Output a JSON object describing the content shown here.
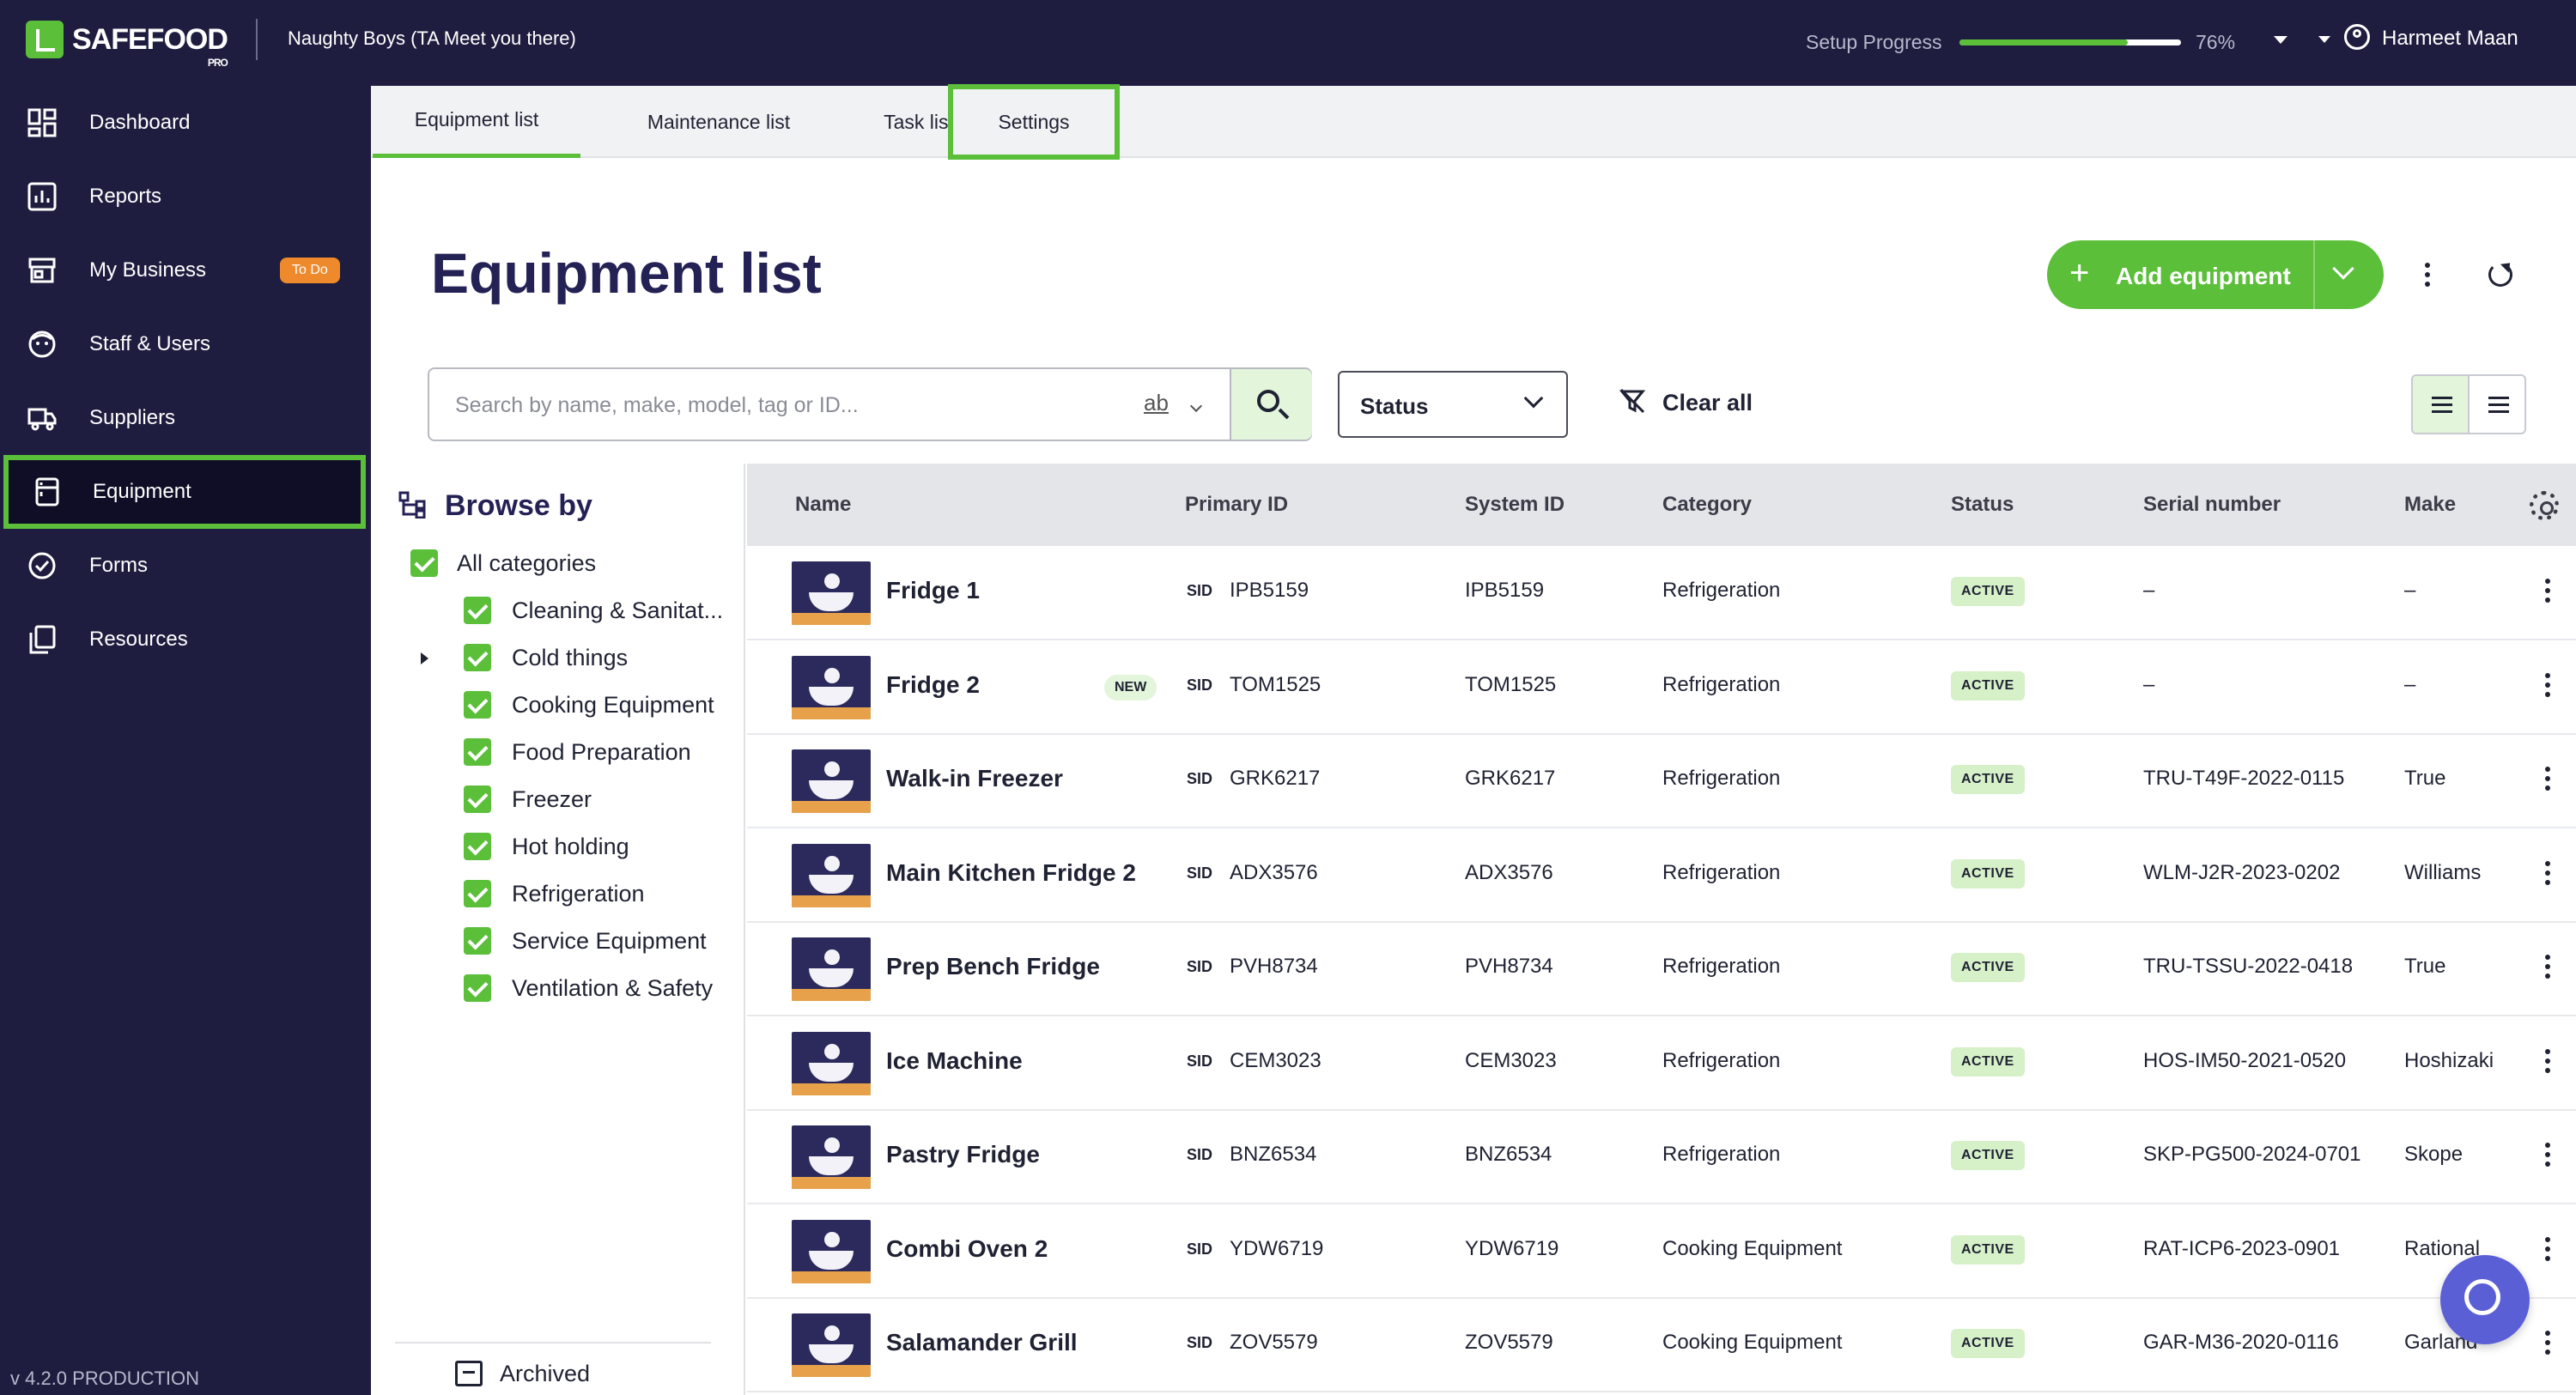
{
  "header": {
    "logo_text": "SAFEFOOD",
    "logo_sub": "PRO",
    "business_name": "Naughty Boys (TA Meet you there)",
    "setup_progress_label": "Setup Progress",
    "setup_progress_value": 76,
    "setup_progress_text": "76%",
    "user_name": "Harmeet Maan"
  },
  "sidebar": {
    "items": [
      {
        "label": "Dashboard",
        "icon": "dashboard-icon"
      },
      {
        "label": "Reports",
        "icon": "reports-icon"
      },
      {
        "label": "My Business",
        "icon": "store-icon",
        "badge": "To Do"
      },
      {
        "label": "Staff & Users",
        "icon": "staff-icon"
      },
      {
        "label": "Suppliers",
        "icon": "truck-icon"
      },
      {
        "label": "Equipment",
        "icon": "equipment-icon",
        "active": true
      },
      {
        "label": "Forms",
        "icon": "check-circle-icon"
      },
      {
        "label": "Resources",
        "icon": "copy-icon"
      }
    ],
    "version": "v 4.2.0 PRODUCTION"
  },
  "tabs": [
    {
      "label": "Equipment list",
      "active": true
    },
    {
      "label": "Maintenance list"
    },
    {
      "label": "Task list"
    },
    {
      "label": "Settings",
      "highlighted": true
    }
  ],
  "page": {
    "title": "Equipment list",
    "add_button_label": "Add equipment"
  },
  "filters": {
    "search_placeholder": "Search by name, make, model, tag or ID...",
    "search_mode": "ab",
    "status_label": "Status",
    "clear_all_label": "Clear all"
  },
  "browse": {
    "title": "Browse by",
    "all_label": "All categories",
    "categories": [
      {
        "label": "Cleaning & Sanitat...",
        "checked": true
      },
      {
        "label": "Cold things",
        "checked": true,
        "expandable": true
      },
      {
        "label": "Cooking Equipment",
        "checked": true
      },
      {
        "label": "Food Preparation",
        "checked": true
      },
      {
        "label": "Freezer",
        "checked": true
      },
      {
        "label": "Hot holding",
        "checked": true
      },
      {
        "label": "Refrigeration",
        "checked": true
      },
      {
        "label": "Service Equipment",
        "checked": true
      },
      {
        "label": "Ventilation & Safety",
        "checked": true
      }
    ],
    "archived_label": "Archived"
  },
  "table": {
    "columns": [
      "Name",
      "Primary ID",
      "System ID",
      "Category",
      "Status",
      "Serial number",
      "Make"
    ],
    "sid_label": "SID",
    "new_label": "NEW",
    "rows": [
      {
        "name": "Fridge 1",
        "primary_id": "IPB5159",
        "system_id": "IPB5159",
        "category": "Refrigeration",
        "status": "ACTIVE",
        "serial": "–",
        "make": "–",
        "is_new": false
      },
      {
        "name": "Fridge 2",
        "primary_id": "TOM1525",
        "system_id": "TOM1525",
        "category": "Refrigeration",
        "status": "ACTIVE",
        "serial": "–",
        "make": "–",
        "is_new": true
      },
      {
        "name": "Walk-in Freezer",
        "primary_id": "GRK6217",
        "system_id": "GRK6217",
        "category": "Refrigeration",
        "status": "ACTIVE",
        "serial": "TRU-T49F-2022-0115",
        "make": "True",
        "is_new": false
      },
      {
        "name": "Main Kitchen Fridge 2",
        "primary_id": "ADX3576",
        "system_id": "ADX3576",
        "category": "Refrigeration",
        "status": "ACTIVE",
        "serial": "WLM-J2R-2023-0202",
        "make": "Williams",
        "is_new": false
      },
      {
        "name": "Prep Bench Fridge",
        "primary_id": "PVH8734",
        "system_id": "PVH8734",
        "category": "Refrigeration",
        "status": "ACTIVE",
        "serial": "TRU-TSSU-2022-0418",
        "make": "True",
        "is_new": false
      },
      {
        "name": "Ice Machine",
        "primary_id": "CEM3023",
        "system_id": "CEM3023",
        "category": "Refrigeration",
        "status": "ACTIVE",
        "serial": "HOS-IM50-2021-0520",
        "make": "Hoshizaki",
        "is_new": false
      },
      {
        "name": "Pastry Fridge",
        "primary_id": "BNZ6534",
        "system_id": "BNZ6534",
        "category": "Refrigeration",
        "status": "ACTIVE",
        "serial": "SKP-PG500-2024-0701",
        "make": "Skope",
        "is_new": false
      },
      {
        "name": "Combi Oven 2",
        "primary_id": "YDW6719",
        "system_id": "YDW6719",
        "category": "Cooking Equipment",
        "status": "ACTIVE",
        "serial": "RAT-ICP6-2023-0901",
        "make": "Rational",
        "is_new": false
      },
      {
        "name": "Salamander Grill",
        "primary_id": "ZOV5579",
        "system_id": "ZOV5579",
        "category": "Cooking Equipment",
        "status": "ACTIVE",
        "serial": "GAR-M36-2020-0116",
        "make": "Garland",
        "is_new": false
      }
    ]
  },
  "colors": {
    "brand_green": "#5bbf3a",
    "navy": "#1e1d3f",
    "title_navy": "#242255",
    "badge_orange": "#ee8a2c",
    "chat_purple": "#5a5fd6"
  }
}
